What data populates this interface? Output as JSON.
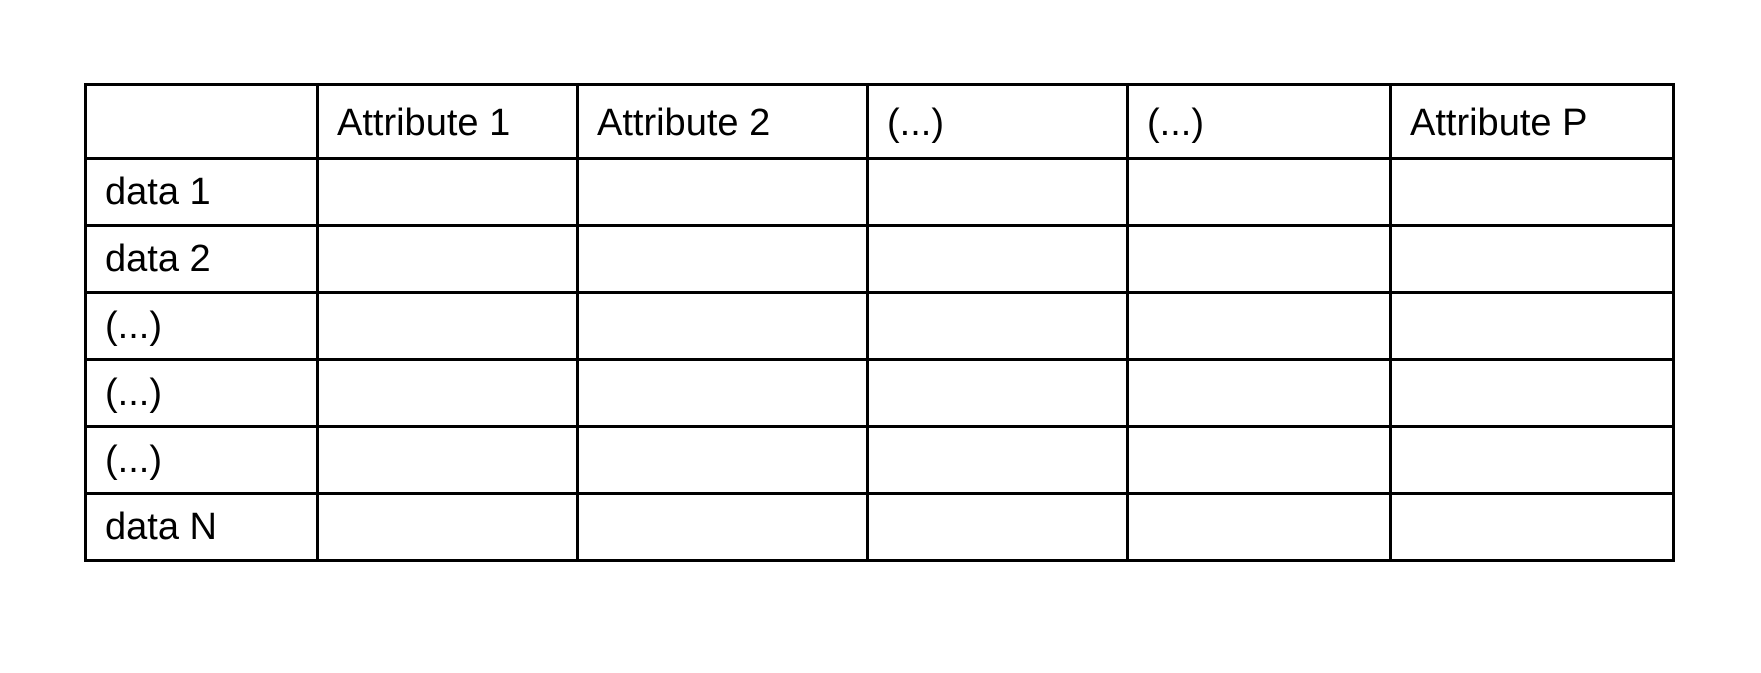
{
  "table": {
    "headers": [
      "",
      "Attribute 1",
      "Attribute 2",
      "(...)",
      "(...)",
      "Attribute P"
    ],
    "rows": [
      {
        "label": "data 1",
        "cells": [
          "",
          "",
          "",
          "",
          ""
        ]
      },
      {
        "label": "data 2",
        "cells": [
          "",
          "",
          "",
          "",
          ""
        ]
      },
      {
        "label": "(...)",
        "cells": [
          "",
          "",
          "",
          "",
          ""
        ]
      },
      {
        "label": "(...)",
        "cells": [
          "",
          "",
          "",
          "",
          ""
        ]
      },
      {
        "label": "(...)",
        "cells": [
          "",
          "",
          "",
          "",
          ""
        ]
      },
      {
        "label": "data N",
        "cells": [
          "",
          "",
          "",
          "",
          ""
        ]
      }
    ]
  }
}
